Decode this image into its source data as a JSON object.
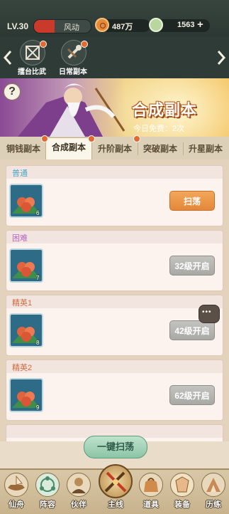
{
  "status": {
    "level": "LV.30",
    "power_label": "风动",
    "power_fill": 0.36,
    "coins": "487万",
    "jade": "1563",
    "plus": "+"
  },
  "modes": [
    {
      "label": "擂台比武",
      "icon": "arena-icon"
    },
    {
      "label": "日常副本",
      "icon": "daily-dungeon-icon"
    }
  ],
  "banner": {
    "help": "?",
    "title": "合成副本",
    "free_text": "今日免费：2次"
  },
  "tabs": [
    {
      "label": "铜钱副本",
      "selected": false,
      "dot": true
    },
    {
      "label": "合成副本",
      "selected": true,
      "dot": true
    },
    {
      "label": "升阶副本",
      "selected": false,
      "dot": true
    },
    {
      "label": "突破副本",
      "selected": false,
      "dot": false
    },
    {
      "label": "升星副本",
      "selected": false,
      "dot": false
    }
  ],
  "stages": [
    {
      "name": "普通",
      "color": "#4aa6c8",
      "count": "6",
      "button": "扫荡",
      "enabled": true
    },
    {
      "name": "困难",
      "color": "#b765c5",
      "count": "7",
      "button": "32级开启",
      "enabled": false
    },
    {
      "name": "精英1",
      "color": "#d06a3a",
      "count": "8",
      "button": "42级开启",
      "enabled": false
    },
    {
      "name": "精英2",
      "color": "#d06a3a",
      "count": "9",
      "button": "62级开启",
      "enabled": false
    }
  ],
  "sweep_all": "一键扫荡",
  "nav": [
    {
      "label": "仙舟",
      "icon": "ship-icon"
    },
    {
      "label": "阵容",
      "icon": "formation-icon"
    },
    {
      "label": "伙伴",
      "icon": "partner-icon"
    },
    {
      "label": "主线",
      "icon": "crossed-swords-icon"
    },
    {
      "label": "道具",
      "icon": "bag-icon"
    },
    {
      "label": "装备",
      "icon": "equipment-icon"
    },
    {
      "label": "历练",
      "icon": "training-icon"
    }
  ]
}
